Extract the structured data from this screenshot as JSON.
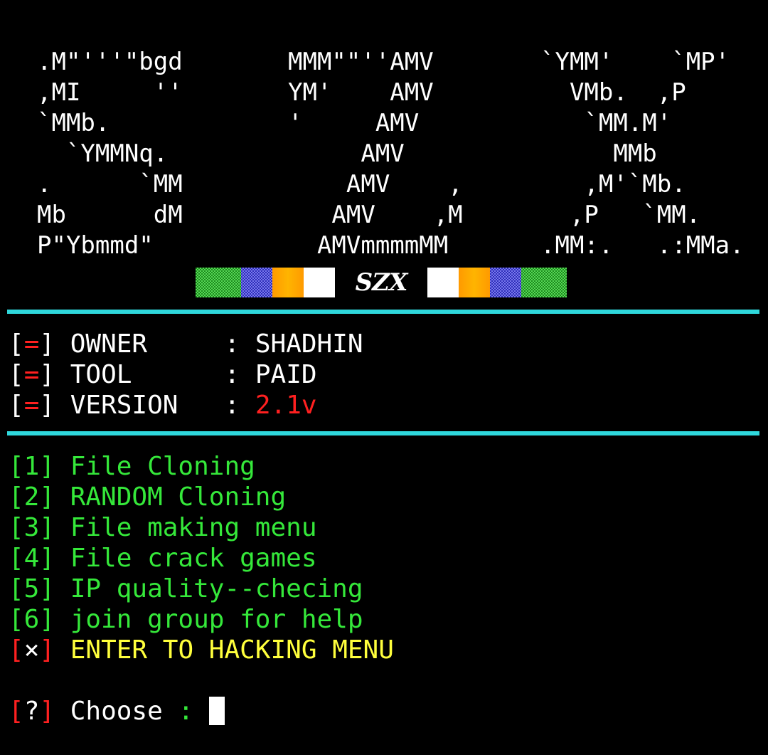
{
  "banner": {
    "ascii_s": ".M\"'''\"bgd\n,MI     ''\n`MMb.\n  `YMMNq.\n.      `MM\nMb      dM\nP\"Ybmmd\"",
    "ascii_z": "MMM\"\"''AMV\nYM'    AMV\n'     AMV\n     AMV\n    AMV    ,\n   AMV    ,M\n  AMVmmmmMM",
    "ascii_x": "`YMM'    `MP'\n  VMb.  ,P\n   `MM.M'\n     MMb\n   ,M'`Mb.\n  ,P   `MM.\n.MM:.   .:MMa.",
    "logo_text": "SZX"
  },
  "info": [
    {
      "open": "[",
      "mark": "=",
      "close": "]",
      "label": " OWNER    ",
      "sep": " : ",
      "value": "SHADHIN"
    },
    {
      "open": "[",
      "mark": "=",
      "close": "]",
      "label": " TOOL     ",
      "sep": " : ",
      "value": "PAID"
    },
    {
      "open": "[",
      "mark": "=",
      "close": "]",
      "label": " VERSION  ",
      "sep": " : ",
      "value": "2.1v"
    }
  ],
  "menu": [
    {
      "key": "[1]",
      "label": " File Cloning"
    },
    {
      "key": "[2]",
      "label": " RANDOM Cloning"
    },
    {
      "key": "[3]",
      "label": " File making menu"
    },
    {
      "key": "[4]",
      "label": " File crack games"
    },
    {
      "key": "[5]",
      "label": " IP quality--checing"
    },
    {
      "key": "[6]",
      "label": " join group for help"
    }
  ],
  "hack": {
    "open": "[",
    "mark": "×",
    "close": "]",
    "label": " ENTER TO HACKING MENU"
  },
  "prompt": {
    "open": "[",
    "mark": "?",
    "close": "]",
    "label": " Choose",
    "sep": " : "
  },
  "colors": {
    "divider": "#2fd8dc",
    "accent_red": "#ff2020",
    "menu_green": "#35e83a",
    "hack_yellow": "#ffff3c",
    "text_white": "#ffffff"
  }
}
